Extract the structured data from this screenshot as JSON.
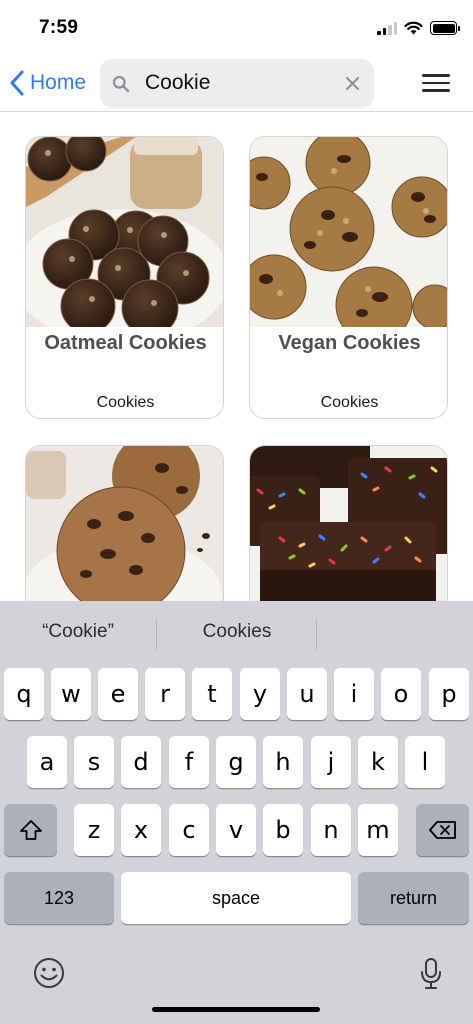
{
  "status_bar": {
    "time": "7:59",
    "signal_icon": "cellular-signal-icon",
    "wifi_icon": "wifi-icon",
    "battery_icon": "battery-icon"
  },
  "nav": {
    "back_label": "Home",
    "back_icon": "chevron-left-icon",
    "search_icon": "magnifying-glass-icon",
    "search_value": "Cookie",
    "clear_icon": "clear-x-icon",
    "menu_icon": "hamburger-menu-icon",
    "accent_color": "#2f7bf5"
  },
  "results": [
    {
      "title": "Oatmeal Cookies",
      "category": "Cookies"
    },
    {
      "title": "Vegan Cookies",
      "category": "Cookies"
    },
    {
      "title": "",
      "category": ""
    },
    {
      "title": "",
      "category": ""
    }
  ],
  "keyboard": {
    "suggestions": [
      "“Cookie”",
      "Cookies",
      ""
    ],
    "row1": [
      "q",
      "w",
      "e",
      "r",
      "t",
      "y",
      "u",
      "i",
      "o",
      "p"
    ],
    "row2": [
      "a",
      "s",
      "d",
      "f",
      "g",
      "h",
      "j",
      "k",
      "l"
    ],
    "row3": [
      "z",
      "x",
      "c",
      "v",
      "b",
      "n",
      "m"
    ],
    "shift_icon": "shift-arrow-icon",
    "delete_icon": "backspace-icon",
    "numbers_label": "123",
    "space_label": "space",
    "return_label": "return",
    "emoji_icon": "emoji-face-icon",
    "dictation_icon": "microphone-icon"
  }
}
